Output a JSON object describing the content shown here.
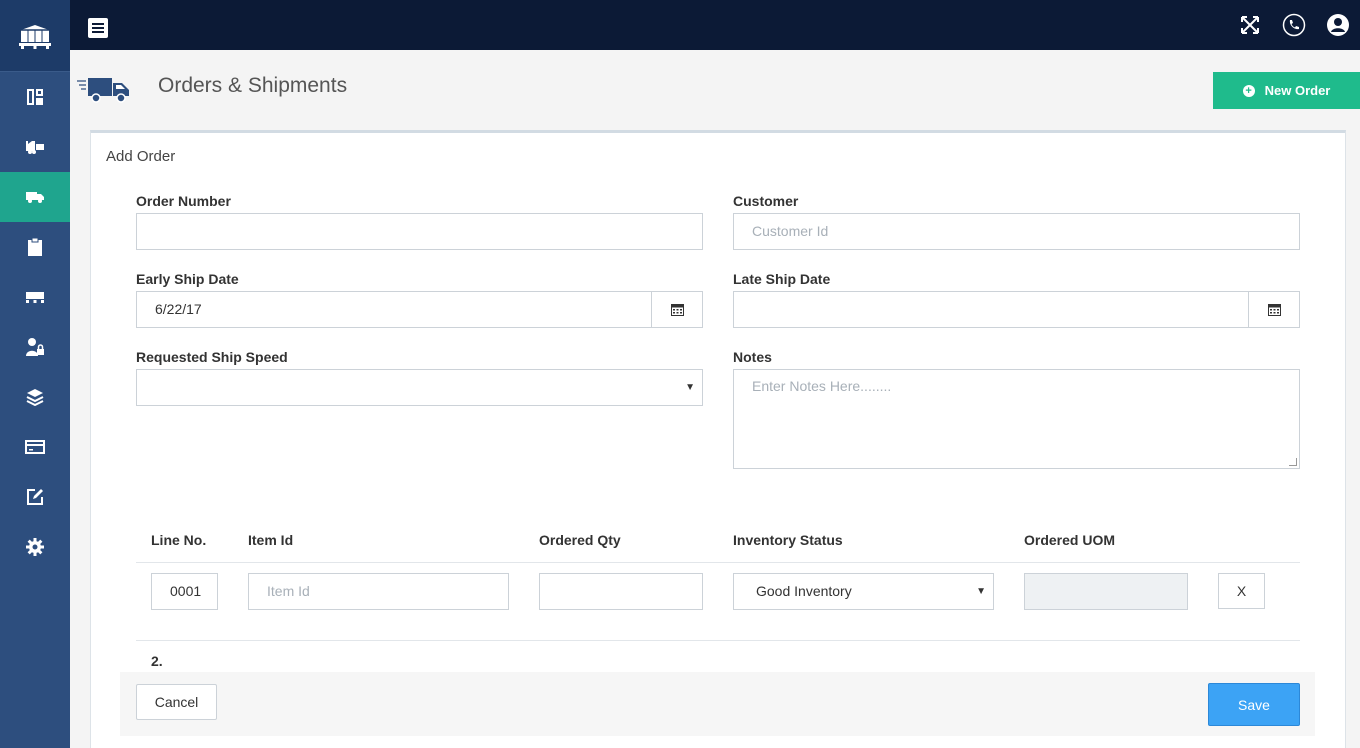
{
  "header": {
    "title": "Orders & Shipments",
    "new_order_label": "New Order"
  },
  "sidebar": {
    "items": [
      {
        "icon": "dashboard-icon"
      },
      {
        "icon": "forklift-icon"
      },
      {
        "icon": "truck-icon",
        "active": true
      },
      {
        "icon": "clipboard-icon"
      },
      {
        "icon": "pallet-icon"
      },
      {
        "icon": "user-lock-icon"
      },
      {
        "icon": "layers-icon"
      },
      {
        "icon": "credit-card-icon"
      },
      {
        "icon": "edit-icon"
      },
      {
        "icon": "gear-icon"
      }
    ]
  },
  "topbar": {
    "icons": [
      "fullscreen-icon",
      "phone-icon",
      "user-icon"
    ]
  },
  "form": {
    "panel_title": "Add Order",
    "order_number": {
      "label": "Order Number",
      "value": ""
    },
    "customer": {
      "label": "Customer",
      "placeholder": "Customer Id"
    },
    "early_ship_date": {
      "label": "Early Ship Date",
      "value": "6/22/17"
    },
    "late_ship_date": {
      "label": "Late Ship Date",
      "value": ""
    },
    "requested_ship_speed": {
      "label": "Requested Ship Speed",
      "value": ""
    },
    "notes": {
      "label": "Notes",
      "placeholder": "Enter Notes Here........"
    }
  },
  "lines": {
    "headers": [
      "Line No.",
      "Item Id",
      "Ordered Qty",
      "Inventory Status",
      "Ordered UOM"
    ],
    "rows": [
      {
        "line_no": "0001",
        "item_placeholder": "Item Id",
        "qty": "",
        "status": "Good Inventory",
        "uom": "",
        "remove_label": "X"
      }
    ],
    "next_line": "2."
  },
  "footer": {
    "cancel_label": "Cancel",
    "save_label": "Save"
  },
  "colors": {
    "sidebar": "#2d4e7e",
    "topbar": "#0c1a36",
    "accent_green": "#1fbb8c",
    "active_teal": "#1fa58e",
    "save_blue": "#3ca3f5"
  }
}
